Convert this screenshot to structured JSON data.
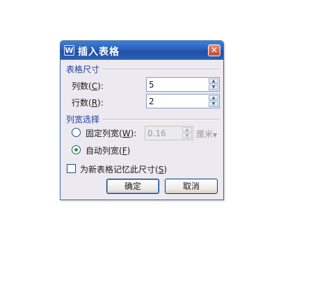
{
  "dialog": {
    "title": "插入表格",
    "app_icon": "W",
    "close_glyph": "✕"
  },
  "table_size": {
    "section_label": "表格尺寸",
    "columns": {
      "label": "列数",
      "accel": "C",
      "suffix": ":",
      "value": "5"
    },
    "rows": {
      "label": "行数",
      "accel": "R",
      "suffix": ":",
      "value": "2"
    }
  },
  "column_width": {
    "section_label": "列宽选择",
    "fixed": {
      "label": "固定列宽",
      "accel": "W",
      "suffix": ":",
      "selected": false,
      "value": "0.16",
      "unit": "厘米"
    },
    "auto": {
      "label": "自动列宽",
      "accel": "F",
      "selected": true
    }
  },
  "remember": {
    "label": "为新表格记忆此尺寸",
    "accel": "S",
    "checked": false
  },
  "buttons": {
    "ok": "确定",
    "cancel": "取消"
  },
  "colors": {
    "titlebar": "#2a5fb8",
    "close": "#c9492b",
    "section_text": "#1f3f99",
    "dialog_bg": "#ece9f0"
  }
}
